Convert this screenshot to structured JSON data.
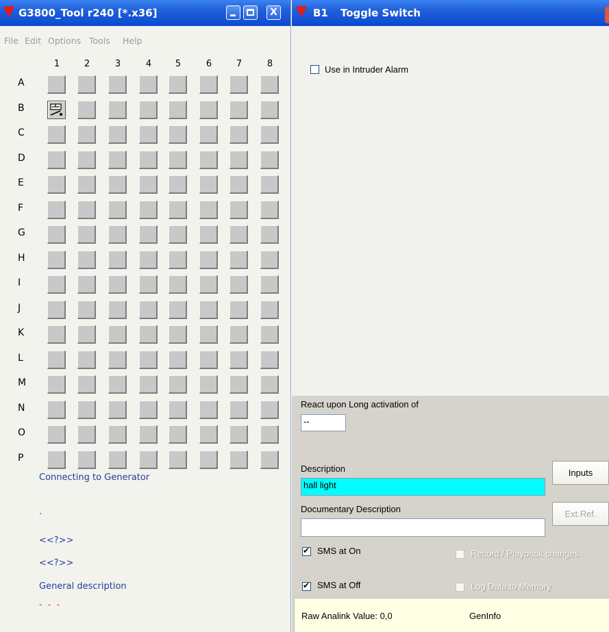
{
  "left_window": {
    "title": "G3800_Tool r240 [*.x36]",
    "controls": {
      "close": "X"
    },
    "menu": [
      "File",
      "Edit",
      "Options",
      "Tools",
      "Help"
    ],
    "grid": {
      "columns": [
        "1",
        "2",
        "3",
        "4",
        "5",
        "6",
        "7",
        "8"
      ],
      "rows": [
        "A",
        "B",
        "C",
        "D",
        "E",
        "F",
        "G",
        "H",
        "I",
        "J",
        "K",
        "L",
        "M",
        "N",
        "O",
        "P"
      ],
      "active_cell": "B1",
      "active_cell_icon": "toggle-switch-icon"
    },
    "status": {
      "connection": "Connecting to Generator",
      "dot": ".",
      "placeholder1": "<<?>>",
      "placeholder2": "<<?>>",
      "general_description": "General description",
      "red_dashes": "- - -"
    }
  },
  "right_window": {
    "title_id": "B1",
    "title_name": "Toggle Switch",
    "intruder_alarm": {
      "label": "Use in Intruder Alarm",
      "checked": false
    },
    "react_label": "React upon Long activation of",
    "react_value": "--",
    "description_label": "Description",
    "description_value": "hall light",
    "inputs_button": "Inputs",
    "doc_description_label": "Documentary Description",
    "doc_description_value": "",
    "ext_ref_button": "Ext.Ref.",
    "sms_on": {
      "label": "SMS at On",
      "checked": true
    },
    "sms_off": {
      "label": "SMS at Off",
      "checked": true
    },
    "record_playback": {
      "label": "Record / Playback changes",
      "checked": false,
      "disabled": true
    },
    "log_data": {
      "label": "Log Data to Memory",
      "checked": false,
      "disabled": true
    },
    "info_bar": {
      "raw_value": "Raw Analink Value: 0,0",
      "gen_info": "GenInfo"
    }
  },
  "colors": {
    "title_bar": "#0b4ad2",
    "description_highlight": "#00ffff",
    "status_text": "#1f3f9a",
    "red_dashes": "#e03030",
    "info_bar_bg": "#ffffe6"
  }
}
